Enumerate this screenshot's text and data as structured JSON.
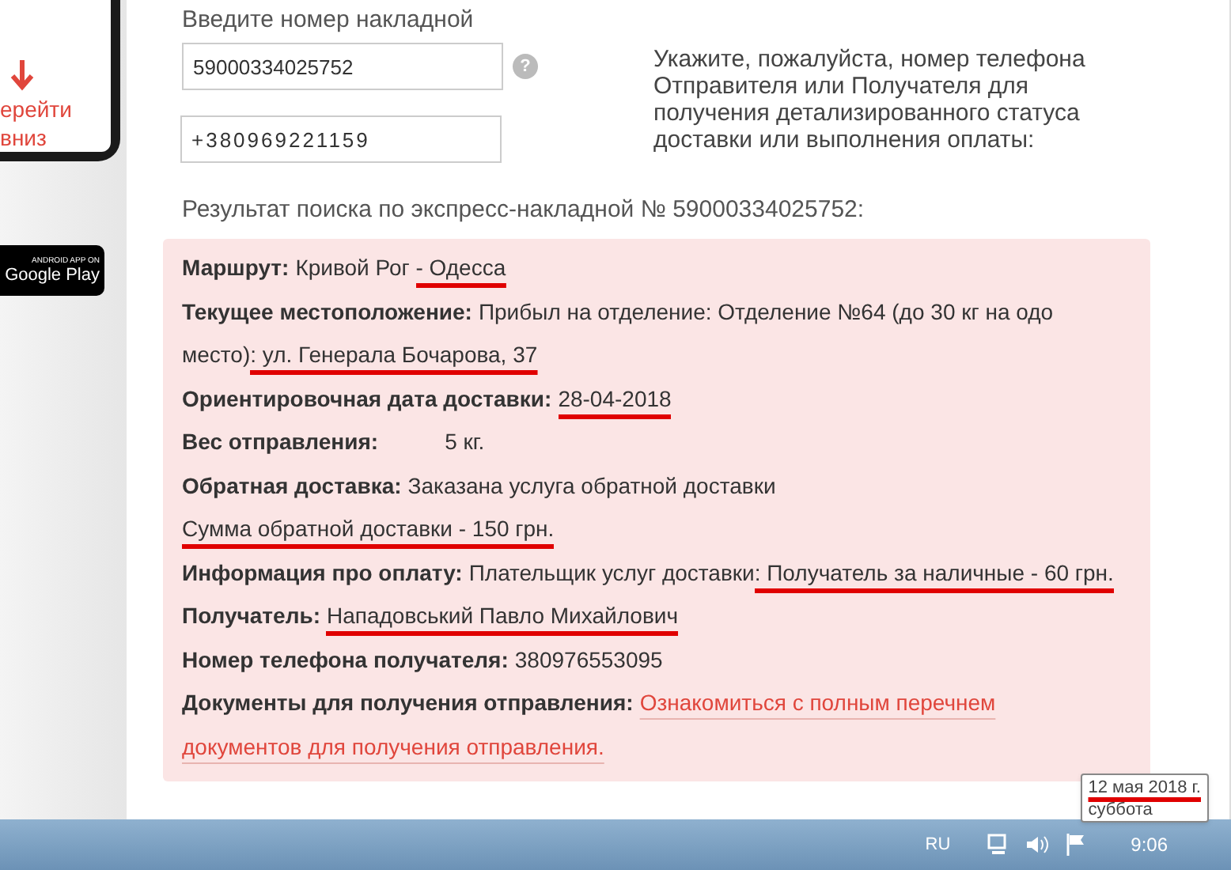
{
  "sidebar": {
    "promo_lines": [
      "ерейти",
      "вниз"
    ],
    "store_badge": {
      "caption": "ANDROID APP ON",
      "label": "Google Play"
    }
  },
  "form": {
    "invoice_label": "Введите номер накладной",
    "invoice_value": "59000334025752",
    "help_icon": "?",
    "phone_value": "+380969221159",
    "hint": "Укажите, пожалуйста, номер телефона Отправителя или Получателя для получения детализированного статуса доставки или выполнения оплаты:"
  },
  "result_heading": "Результат поиска по экспресс-накладной № 59000334025752:",
  "result_rows": [
    {
      "label": "Маршрут:",
      "parts": [
        {
          "kind": "text",
          "text": "Кривой Рог ",
          "marked": false
        },
        {
          "kind": "text",
          "text": "- Одесса",
          "marked": true
        }
      ]
    },
    {
      "label": "Текущее местоположение:",
      "parts": [
        {
          "kind": "text",
          "text": "Прибыл на отделение: Отделение №64 (до 30 кг на одо место)",
          "marked": false
        },
        {
          "kind": "text",
          "text": ": ул. Генерала Бочарова, 37",
          "marked": true
        }
      ]
    },
    {
      "label": "Ориентировочная дата доставки:",
      "parts": [
        {
          "kind": "text",
          "text": "28-04-2018",
          "marked": true
        }
      ]
    },
    {
      "label": "Вес отправления:",
      "parts": [
        {
          "kind": "gap",
          "text": "5 кг.",
          "marked": false
        }
      ]
    },
    {
      "label": "Обратная доставка:",
      "parts": [
        {
          "kind": "text",
          "text": "Заказана услуга обратной доставки",
          "marked": false
        }
      ]
    },
    {
      "parts": [
        {
          "kind": "text",
          "text": "Сумма обратной доставки - 150 грн.",
          "marked": true
        }
      ]
    },
    {
      "label": "Информация про оплату:",
      "parts": [
        {
          "kind": "text",
          "text": "Плательщик услуг доставки",
          "marked": false
        },
        {
          "kind": "text",
          "text": ": Получатель за наличные - 60 грн.",
          "marked": true
        }
      ]
    },
    {
      "label": "Получатель:",
      "parts": [
        {
          "kind": "text",
          "text": "Нападовський Павло Михайлович",
          "marked": true
        }
      ]
    },
    {
      "label": "Номер телефона получателя:",
      "parts": [
        {
          "kind": "text",
          "text": "380976553095",
          "marked": false
        }
      ]
    },
    {
      "label": "Документы для получения отправления:",
      "parts": [
        {
          "kind": "link",
          "text": "Ознакомиться с полным перечнем",
          "marked": false
        },
        {
          "kind": "link",
          "text": "документов для получения отправления.",
          "marked": false
        }
      ]
    }
  ],
  "taskbar": {
    "language": "RU",
    "time": "9:06"
  },
  "tooltip": {
    "date": "12 мая 2018 г.",
    "date_marked": true,
    "weekday": "суббота"
  }
}
